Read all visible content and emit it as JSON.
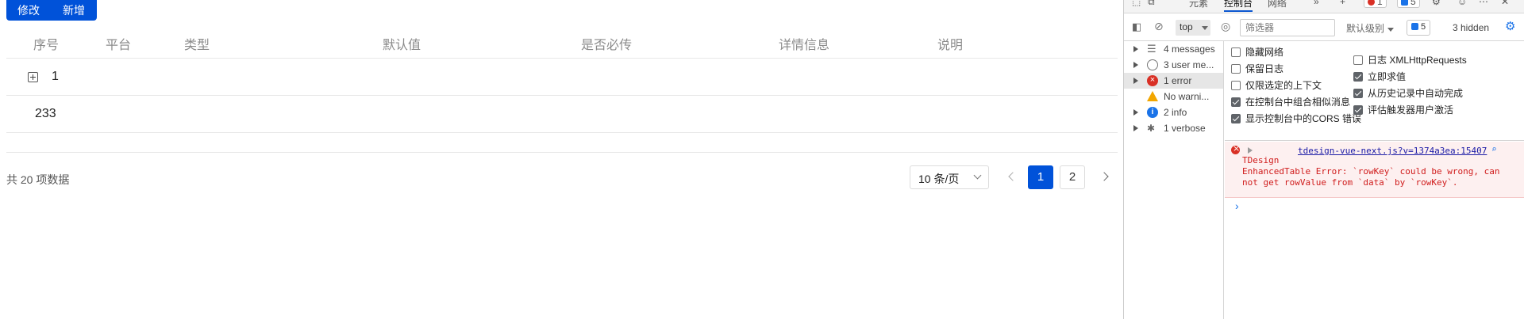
{
  "app": {
    "buttons": {
      "edit": "修改",
      "add": "新增"
    },
    "table": {
      "columns": [
        "序号",
        "平台",
        "类型",
        "默认值",
        "是否必传",
        "详情信息",
        "说明"
      ],
      "rows": [
        {
          "index": "1",
          "expandable": true
        },
        {
          "index": "233",
          "expandable": false
        }
      ]
    },
    "pagination": {
      "total": "共 20 项数据",
      "page_size": "10 条/页",
      "pages": [
        "1",
        "2"
      ],
      "current": "1"
    }
  },
  "devtools": {
    "tabs": {
      "elements": "元素",
      "console": "控制台",
      "network": "网络",
      "more": "»",
      "add": "+"
    },
    "badges": {
      "errors": "1",
      "issues": "5"
    },
    "toolbar": {
      "context": "top",
      "filter_placeholder": "筛选器",
      "levels": "默认级别",
      "issues": "5",
      "hidden": "3 hidden"
    },
    "sidebar": [
      {
        "label": "4 messages",
        "icon": "list-icon",
        "selected": false
      },
      {
        "label": "3 user me...",
        "icon": "user-icon",
        "selected": false
      },
      {
        "label": "1 error",
        "icon": "error-icon",
        "selected": true
      },
      {
        "label": "No warni...",
        "icon": "warning-icon",
        "selected": false
      },
      {
        "label": "2 info",
        "icon": "info-icon",
        "selected": false
      },
      {
        "label": "1 verbose",
        "icon": "bug-icon",
        "selected": false
      }
    ],
    "settings_left": [
      {
        "label": "隐藏网络",
        "checked": false
      },
      {
        "label": "保留日志",
        "checked": false
      },
      {
        "label": "仅限选定的上下文",
        "checked": false
      },
      {
        "label": "在控制台中组合相似消息",
        "checked": true
      },
      {
        "label": "显示控制台中的CORS 错误",
        "checked": true
      }
    ],
    "settings_right": [
      {
        "label": "日志 XMLHttpRequests",
        "checked": false
      },
      {
        "label": "立即求值",
        "checked": true
      },
      {
        "label": "从历史记录中自动完成",
        "checked": true
      },
      {
        "label": "评估触发器用户激活",
        "checked": true
      }
    ],
    "console": {
      "source": "tdesign-vue-next.js?v=1374a3ea:15407",
      "line1": "TDesign",
      "line2": "EnhancedTable Error: `rowKey` could be wrong, can",
      "line3": "not get rowValue from `data` by `rowKey`.",
      "prompt": "›"
    }
  },
  "colors": {
    "primary": "#0052d9",
    "error": "#d93025",
    "link": "#1a1aa6"
  }
}
